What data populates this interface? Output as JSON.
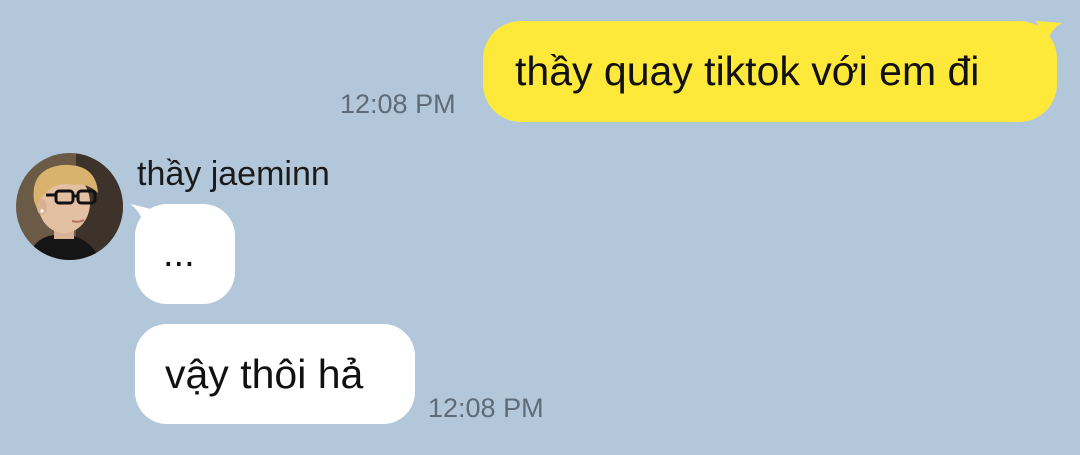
{
  "messages": {
    "outgoing": {
      "text": "thầy quay tiktok với em đi",
      "time": "12:08 PM"
    },
    "incoming": {
      "sender": "thầy jaeminn",
      "avatar_icon": "profile-avatar",
      "bubbles": [
        {
          "text": "..."
        },
        {
          "text": "vậy thôi hả"
        }
      ],
      "time": "12:08 PM"
    }
  },
  "colors": {
    "background": "#b2c7da",
    "outgoing_bubble": "#fee93a",
    "incoming_bubble": "#ffffff",
    "timestamp": "#5f6b77"
  }
}
